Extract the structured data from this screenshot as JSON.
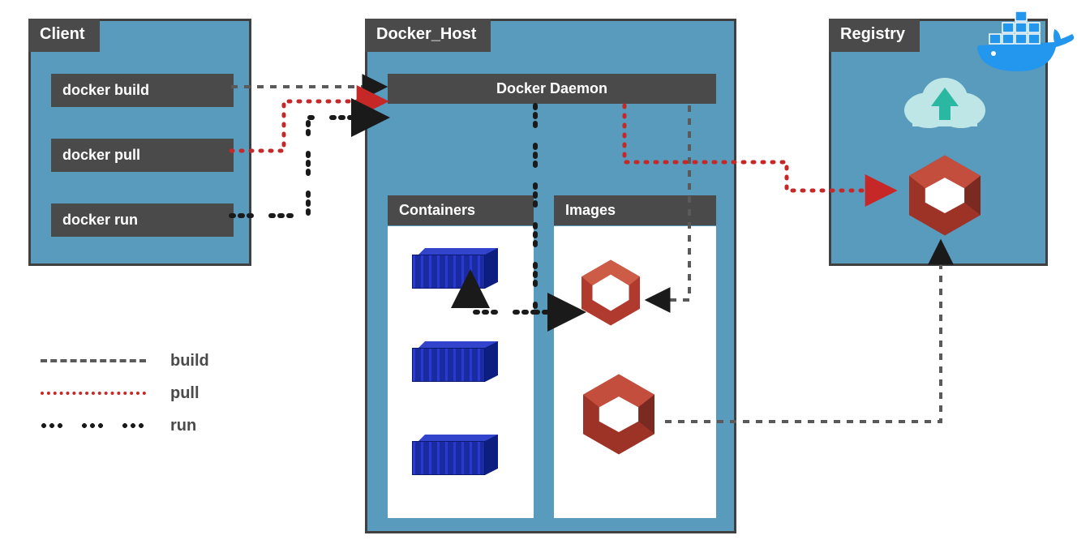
{
  "client": {
    "title": "Client",
    "commands": [
      "docker build",
      "docker pull",
      "docker run"
    ]
  },
  "host": {
    "title": "Docker_Host",
    "daemon_label": "Docker Daemon",
    "containers_label": "Containers",
    "images_label": "Images"
  },
  "registry": {
    "title": "Registry"
  },
  "legend": {
    "build": "build",
    "pull": "pull",
    "run": "run"
  },
  "icons": {
    "docker_whale": "docker-whale-icon",
    "cloud_upload": "cloud-upload-icon",
    "red_hex_image": "docker-image-icon",
    "shipping_container": "shipping-container-icon"
  }
}
